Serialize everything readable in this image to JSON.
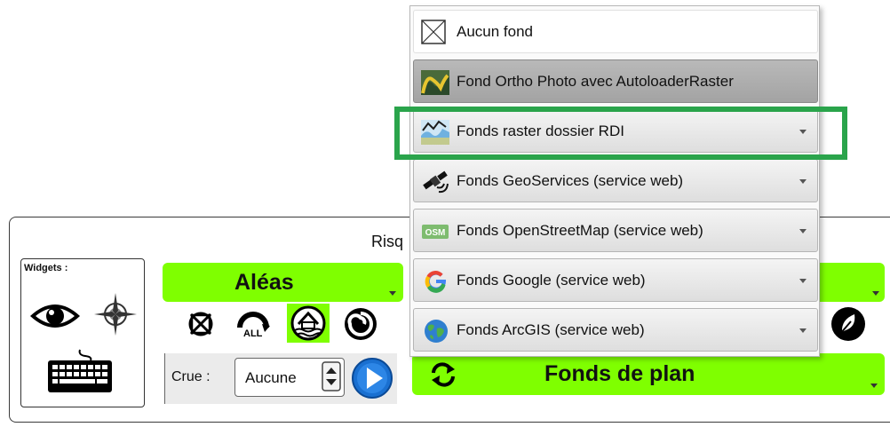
{
  "panel": {
    "title": "Risq"
  },
  "widgets": {
    "label": "Widgets :",
    "icons": [
      "eye-icon",
      "compass-icon",
      "keyboard-icon"
    ]
  },
  "aleas": {
    "label": "Aléas",
    "color": "#7fff00",
    "icons": [
      "no-layer-icon",
      "all-icon",
      "flood-house-icon",
      "spiral-icon"
    ]
  },
  "crue": {
    "label": "Crue :",
    "value": "Aucune"
  },
  "fonds": {
    "label": "Fonds de plan",
    "color": "#7fff00"
  },
  "menu": {
    "items": [
      {
        "label": "Aucun fond",
        "icon": "empty-box-icon"
      },
      {
        "label": "Fond Ortho Photo avec AutoloaderRaster",
        "icon": "ortho-photo-icon"
      },
      {
        "label": "Fonds raster dossier RDI",
        "icon": "raster-map-icon"
      },
      {
        "label": "Fonds GeoServices (service web)",
        "icon": "satellite-icon"
      },
      {
        "label": "Fonds OpenStreetMap (service web)",
        "icon": "osm-icon",
        "badge": "OSM"
      },
      {
        "label": "Fonds Google (service web)",
        "icon": "google-icon"
      },
      {
        "label": "Fonds ArcGIS (service web)",
        "icon": "globe-icon"
      }
    ]
  },
  "highlight_color": "#2aa44b"
}
